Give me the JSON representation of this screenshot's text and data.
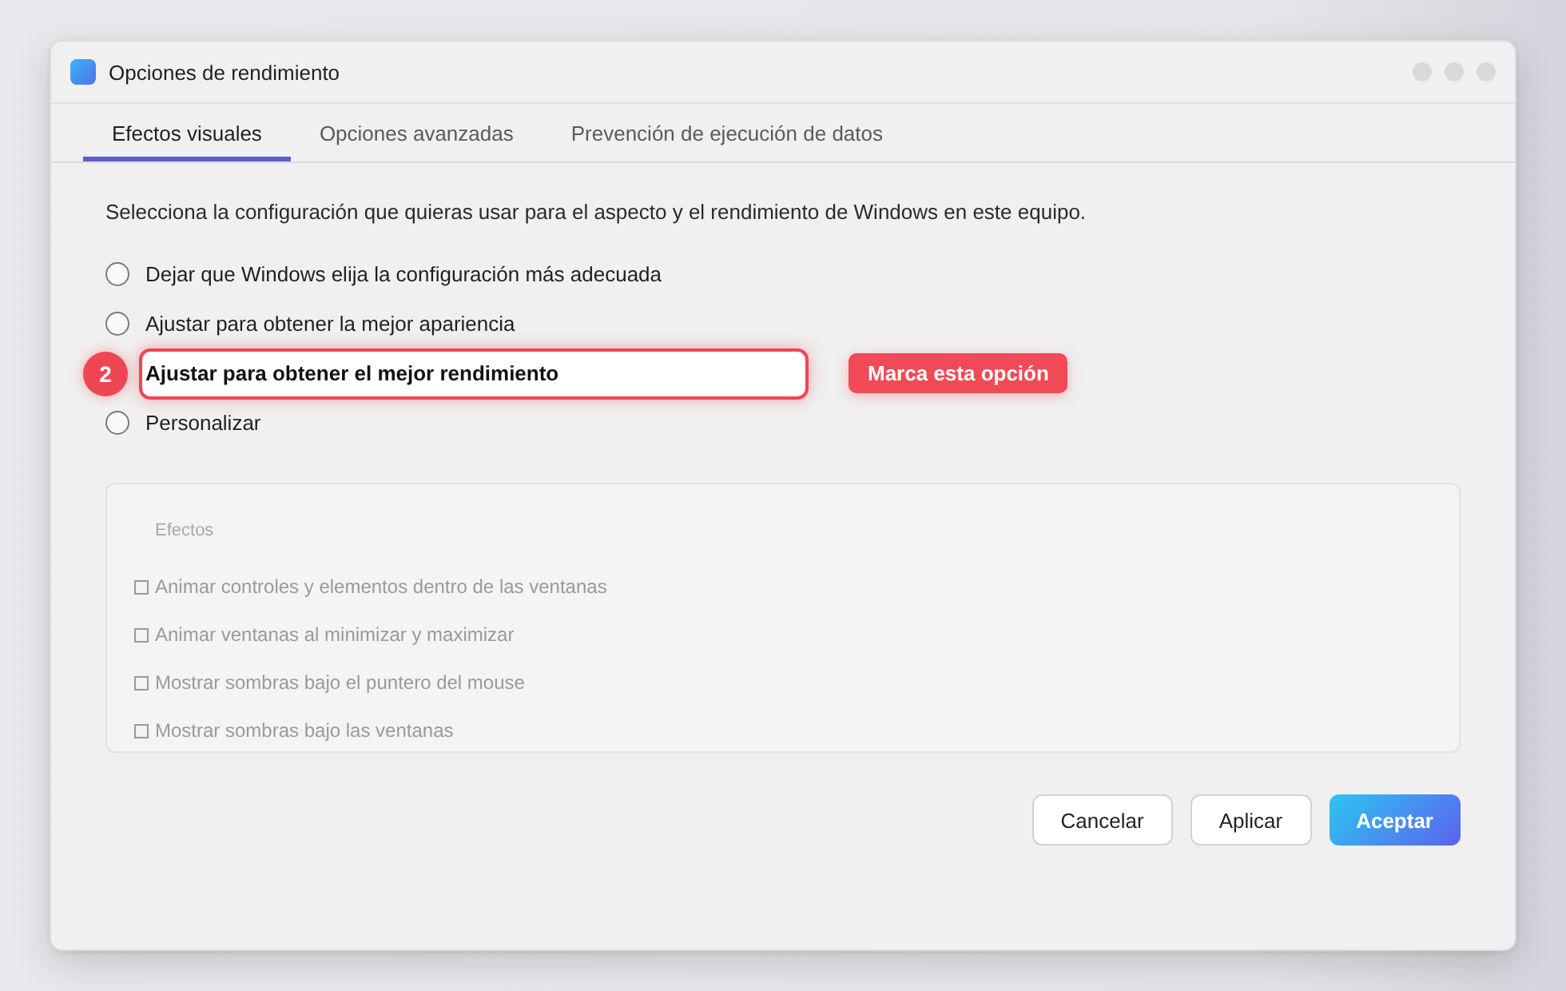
{
  "window": {
    "title": "Opciones de rendimiento"
  },
  "tabs": [
    {
      "label": "Efectos visuales",
      "selected": true
    },
    {
      "label": "Opciones avanzadas",
      "selected": false
    },
    {
      "label": "Prevención de ejecución de datos",
      "selected": false
    }
  ],
  "description": "Selecciona la configuración que quieras usar para el aspecto y el rendimiento de Windows en este equipo.",
  "options": [
    {
      "label": "Dejar que Windows elija la configuración más adecuada",
      "selected": false
    },
    {
      "label": "Ajustar para obtener la mejor apariencia",
      "selected": false
    },
    {
      "label": "Ajustar para obtener el mejor rendimiento",
      "highlighted": true,
      "step": "2",
      "callout": "Marca esta opción"
    },
    {
      "label": "Personalizar",
      "selected": false
    }
  ],
  "effects": {
    "title": "Efectos",
    "disabled": true,
    "items": [
      {
        "label": "Animar controles y elementos dentro de las ventanas",
        "checked": false
      },
      {
        "label": "Animar ventanas al minimizar y maximizar",
        "checked": false
      },
      {
        "label": "Mostrar sombras bajo el puntero del mouse",
        "checked": false
      },
      {
        "label": "Mostrar sombras bajo las ventanas",
        "checked": false
      }
    ]
  },
  "buttons": [
    {
      "label": "Cancelar",
      "kind": "secondary"
    },
    {
      "label": "Aplicar",
      "kind": "secondary"
    },
    {
      "label": "Aceptar",
      "kind": "primary"
    }
  ]
}
